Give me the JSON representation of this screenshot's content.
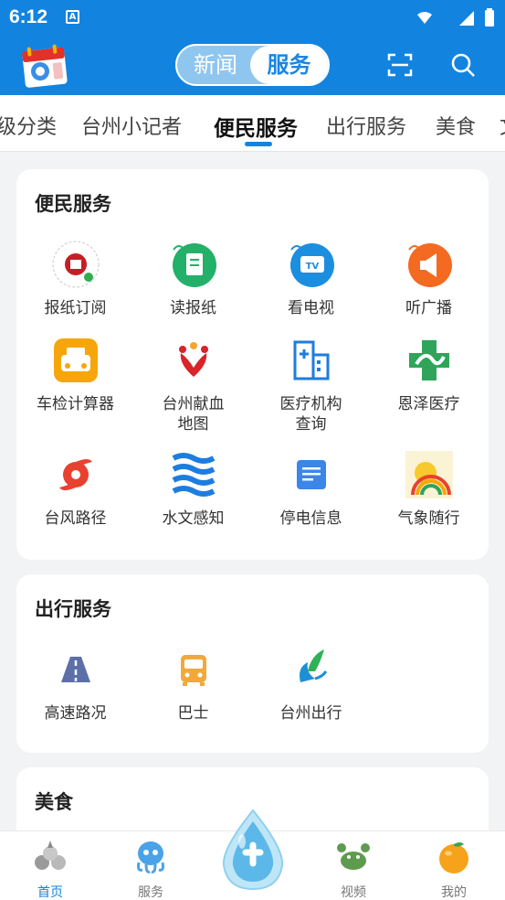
{
  "status": {
    "time": "6:12",
    "a_icon": "A"
  },
  "header": {
    "segment": {
      "news": "新闻",
      "service": "服务",
      "selected": "服务"
    },
    "icons": [
      "calendar-logo-icon",
      "scan-icon",
      "search-icon"
    ]
  },
  "tabs": {
    "items": [
      "级分类",
      "台州小记者",
      "便民服务",
      "出行服务",
      "美食",
      "文"
    ],
    "active": "便民服务"
  },
  "sections": [
    {
      "title": "便民服务",
      "items": [
        {
          "label": "报纸订阅",
          "icon": "qr-newspaper-icon"
        },
        {
          "label": "读报纸",
          "icon": "read-newspaper-icon"
        },
        {
          "label": "看电视",
          "icon": "tv-icon"
        },
        {
          "label": "听广播",
          "icon": "radio-megaphone-icon"
        },
        {
          "label": "车检计算器",
          "icon": "taxi-icon"
        },
        {
          "label": "台州献血\n地图",
          "icon": "blood-donation-icon"
        },
        {
          "label": "医疗机构\n查询",
          "icon": "hospital-building-icon"
        },
        {
          "label": "恩泽医疗",
          "icon": "medical-cross-icon"
        },
        {
          "label": "台风路径",
          "icon": "typhoon-icon"
        },
        {
          "label": "水文感知",
          "icon": "water-waves-icon"
        },
        {
          "label": "停电信息",
          "icon": "notice-icon"
        },
        {
          "label": "气象随行",
          "icon": "rainbow-sun-icon"
        }
      ]
    },
    {
      "title": "出行服务",
      "items": [
        {
          "label": "高速路况",
          "icon": "highway-icon"
        },
        {
          "label": "巴士",
          "icon": "bus-icon"
        },
        {
          "label": "台州出行",
          "icon": "taizhou-travel-icon"
        }
      ]
    },
    {
      "title": "美食",
      "items": []
    }
  ],
  "bottom_nav": [
    {
      "label": "首页",
      "icon": "home-icon",
      "active": true
    },
    {
      "label": "服务",
      "icon": "service-octopus-icon",
      "active": false
    },
    {
      "label": "",
      "icon": "center-drop-plus-icon",
      "active": false
    },
    {
      "label": "视频",
      "icon": "video-crab-icon",
      "active": false
    },
    {
      "label": "我的",
      "icon": "mine-orange-icon",
      "active": false
    }
  ]
}
